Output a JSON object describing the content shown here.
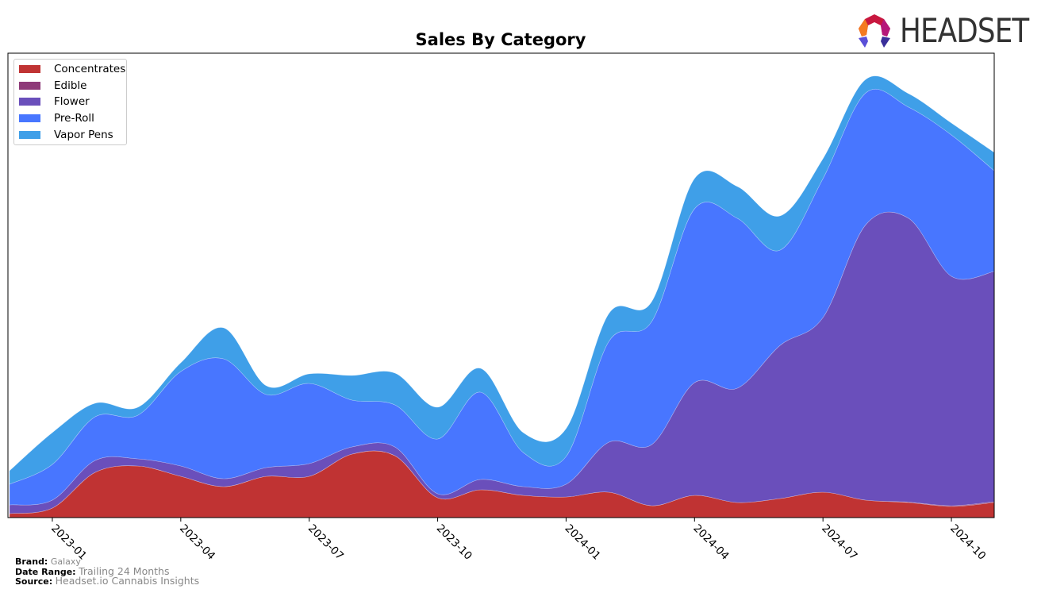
{
  "chart_data": {
    "type": "area",
    "stacked": true,
    "title": "Sales By Category",
    "xlabel": "",
    "ylabel": "",
    "x": [
      "2022-12",
      "2023-01",
      "2023-02",
      "2023-03",
      "2023-04",
      "2023-05",
      "2023-06",
      "2023-07",
      "2023-08",
      "2023-09",
      "2023-10",
      "2023-11",
      "2023-12",
      "2024-01",
      "2024-02",
      "2024-03",
      "2024-04",
      "2024-05",
      "2024-06",
      "2024-07",
      "2024-08",
      "2024-09",
      "2024-10",
      "2024-11"
    ],
    "xticks": [
      "2023-01",
      "2023-04",
      "2023-07",
      "2023-10",
      "2024-01",
      "2024-04",
      "2024-07",
      "2024-10"
    ],
    "ylim": [
      0,
      585
    ],
    "y_axis_shown": false,
    "grid": false,
    "legend_position": "top-left",
    "series": [
      {
        "name": "Concentrates",
        "color": "#c03333",
        "values": [
          5,
          12,
          57,
          65,
          52,
          39,
          52,
          52,
          80,
          78,
          25,
          35,
          28,
          26,
          32,
          15,
          28,
          19,
          24,
          32,
          22,
          19,
          14,
          19
        ]
      },
      {
        "name": "Edible",
        "color": "#8e3a78",
        "values": [
          0,
          0,
          0,
          0,
          0,
          0,
          0,
          0,
          0,
          0,
          0,
          0,
          0,
          0,
          0,
          0,
          0,
          0,
          0,
          0,
          0,
          0.5,
          1,
          1
        ]
      },
      {
        "name": "Flower",
        "color": "#6a4fbb",
        "values": [
          11,
          10,
          15,
          9,
          13,
          10,
          11,
          16,
          9,
          11,
          5,
          13,
          11,
          16,
          63,
          77,
          142,
          144,
          193,
          220,
          347,
          357.5,
          289,
          290
        ]
      },
      {
        "name": "Pre-Roll",
        "color": "#4876ff",
        "values": [
          26,
          45,
          55,
          55,
          119,
          151,
          92,
          101,
          59,
          53,
          69,
          110,
          43,
          35,
          127,
          155,
          219,
          214,
          120,
          175,
          166,
          140,
          178,
          127
        ]
      },
      {
        "name": "Vapor Pens",
        "color": "#3f9fe8",
        "values": [
          17,
          40,
          17,
          10,
          11,
          39,
          11,
          12,
          31,
          40,
          40,
          30,
          25,
          35,
          35,
          25,
          38,
          40,
          43,
          25,
          17,
          17,
          15,
          23
        ]
      }
    ]
  },
  "footer": {
    "brand_label": "Brand:",
    "brand": "Galaxy",
    "date_range_label": "Date Range:",
    "date_range": "Trailing 24 Months",
    "source_label": "Source:",
    "source": "Headset.io Cannabis Insights"
  },
  "logo": {
    "text": "HEADSET"
  }
}
